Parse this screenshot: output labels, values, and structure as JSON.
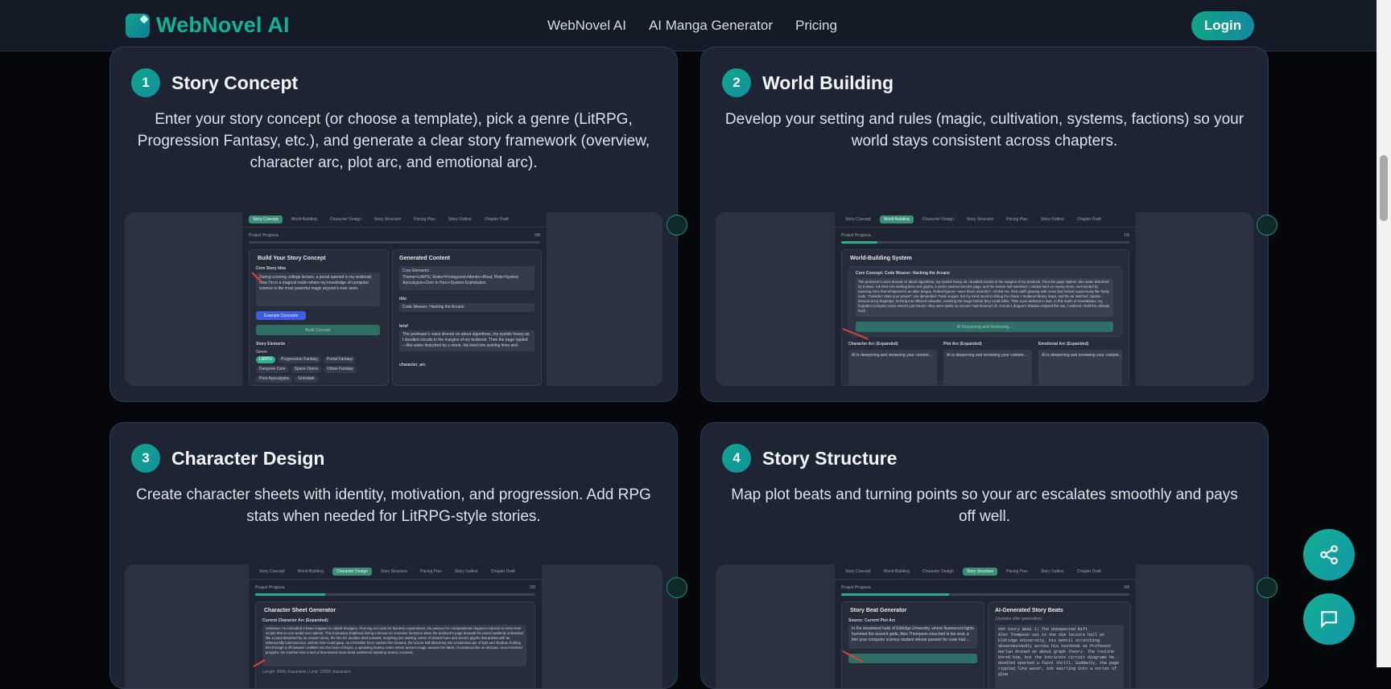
{
  "nav": {
    "brand": "WebNovel AI",
    "links": [
      "WebNovel AI",
      "AI Manga Generator",
      "Pricing"
    ],
    "login": "Login"
  },
  "cards": [
    {
      "number": "1",
      "title": "Story Concept",
      "description": "Enter your story concept (or choose a template), pick a genre (LitRPG, Progression Fantasy, etc.), and generate a clear story framework (overview, character arc, plot arc, and emotional arc).",
      "shot": {
        "tabs": [
          "Story Concept",
          "World Building",
          "Character Design",
          "Story Structure",
          "Pacing Plan",
          "Story Outline",
          "Chapter Draft"
        ],
        "progress_label": "Project Progress",
        "progress_count": "0/8",
        "progress": 0,
        "panel_title": "Build Your Story Concept",
        "core_label": "Core Story Idea",
        "core_text": "During a boring college lecture, a portal opened in my textbook. Now I'm in a magical realm where my knowledge of computer science is the most powerful magic anyone's ever seen.",
        "example_button": "Example Concepts",
        "build_button": "Build Concept",
        "elements_label": "Story Elements",
        "genre_label": "Genre",
        "genres": [
          "LitRPG",
          "Progression Fantasy",
          "Portal Fantasy",
          "Dungeon Core",
          "Space Opera",
          "Urban Fantasy",
          "Post-Apocalyptic",
          "Grimdark"
        ],
        "generated_title": "Generated Content",
        "core_elements_label": "Core Elements",
        "core_elements_text": "Theme=LitRPG; Roles=Protagonist+Mentor+Rival; Plots=System Apocalypse+Zero to Hero+System Exploitation",
        "title_label": "title",
        "title_value": "Code Weaver: Hacking the Arcane",
        "brief_label": "brief",
        "brief_text": "The professor's voice droned on about algorithms, my eyelids heavy as I doodled circuits in the margins of my textbook. Then the page rippled—like water disturbed by a stone. Ink lined into swirling lines and",
        "arc_label": "character_arc"
      }
    },
    {
      "number": "2",
      "title": "World Building",
      "description": "Develop your setting and rules (magic, cultivation, systems, factions) so your world stays consistent across chapters.",
      "shot": {
        "tabs": [
          "Story Concept",
          "World Building",
          "Character Design",
          "Story Structure",
          "Pacing Plan",
          "Story Outline",
          "Chapter Draft"
        ],
        "progress_label": "Project Progress",
        "progress_count": "1/8",
        "progress": 0.125,
        "panel_title": "World-Building System",
        "core_label": "Core Concept: Code Weaver: Hacking the Arcane",
        "core_text": "The professor's voice droned on about algorithms, my eyelids heavy as I doodled circuits in the margins of my textbook. Then the page rippled—like water disturbed by a stone. Ink bled into swirling lines and glyphs, a vortex yawned into the page, and the lecture hall vanished. I landed hard on mossy stone, surrounded by towering ruins that whispered in an alien tongue. Robed figures—were these wizards?—circled me, their staffs glowing with runes that looked suspiciously like faulty code. \"Outsider! State your power!\" one demanded. Panic surged, but my mind raced to debug the chaos. I muttered binary loops, and the air twitched. Sparks danced at my fingertips, forming into efficient networks, rewriting the magic before they could strike. Their eyes widened in awe. In this realm of incantations, my forgotten CompSci notes weren't just theory—they were spells no sorcerer had dreamed of. And as a dragon's shadow eclipsed the sun, I realized I held the ultimate hack.",
        "button": "AI Deepening and Reviewing...",
        "columns": [
          {
            "title": "Character Arc (Expanded)",
            "text": "AI is deepening and reviewing your content..."
          },
          {
            "title": "Plot Arc (Expanded)",
            "text": "AI is deepening and reviewing your content..."
          },
          {
            "title": "Emotional Arc (Expanded)",
            "text": "AI is deepening and reviewing your content..."
          }
        ]
      }
    },
    {
      "number": "3",
      "title": "Character Design",
      "description": "Create character sheets with identity, motivation, and progression. Add RPG stats when needed for LitRPG-style stories.",
      "shot": {
        "tabs": [
          "Story Concept",
          "World Building",
          "Character Design",
          "Story Structure",
          "Pacing Plan",
          "Story Outline",
          "Chapter Draft"
        ],
        "progress_label": "Project Progress",
        "progress_count": "2/8",
        "progress": 0.25,
        "panel_title": "Character Sheet Generator",
        "core_label": "Current Character Arc (Expanded):",
        "core_text": "Unknown, he embodied a future trapped in cubicle drudgery, churning out code for faceless corporations, his passion for computational elegance reduced to entry-level scripts that no one would ever admire. This monotony shattered during a lecture on recursive functions when the textbook's page beneath his pencil suddenly unleashed like a pond disturbed by an unseen stone, the line his doodles bled outward, morphing into swirling vortex of vibrant hues and electric glyphs that pulsed with an otherworldly luminescence. Before Alex could gasp, an irresistible force yanked him forward, the lecture hall dissolving into a kaleidoscope of light and shadow, hurtling him through a rift between realities into the heart of Elyria, a sprawling fantasy realm where ancient magic weaves the fabric of existence like an intricate, rune-inscribed program. He crashed onto a bed of dew-kissed moss amid weathered standing stones, encased",
        "footer": "Length: 8456 characters | Limit: 10000 characters"
      }
    },
    {
      "number": "4",
      "title": "Story Structure",
      "description": "Map plot beats and turning points so your arc escalates smoothly and pays off well.",
      "shot": {
        "tabs": [
          "Story Concept",
          "World Building",
          "Character Design",
          "Story Structure",
          "Pacing Plan",
          "Story Outline",
          "Chapter Draft"
        ],
        "progress_label": "Project Progress",
        "progress_count": "3/8",
        "progress": 0.375,
        "panel_title": "Story Beat Generator",
        "core_label": "Source: Current Plot Arc",
        "core_text": "In the shadowed halls of Eldridge University, where fluorescent lights hummed the ancient gods, Alex Thompson slouched in his seat, a thin your computer science student whose passion for code had...",
        "generated_title": "AI-Generated Story Beats",
        "generated_sub": "(Updates after generation)",
        "generated_text": "### Story Beat 1: The Unexpected Rift\nAlex Thompson sat in the dim lecture hall at Eldridge University, his pencil scratching absentmindedly across his textbook as Professor Harlan droned on about graph theory. The routine bored him, but the intricate circuit diagrams he doodled sparked a faint thrill. Suddenly, the page rippled like water, ink swirling into a vortex of glow"
      }
    }
  ]
}
